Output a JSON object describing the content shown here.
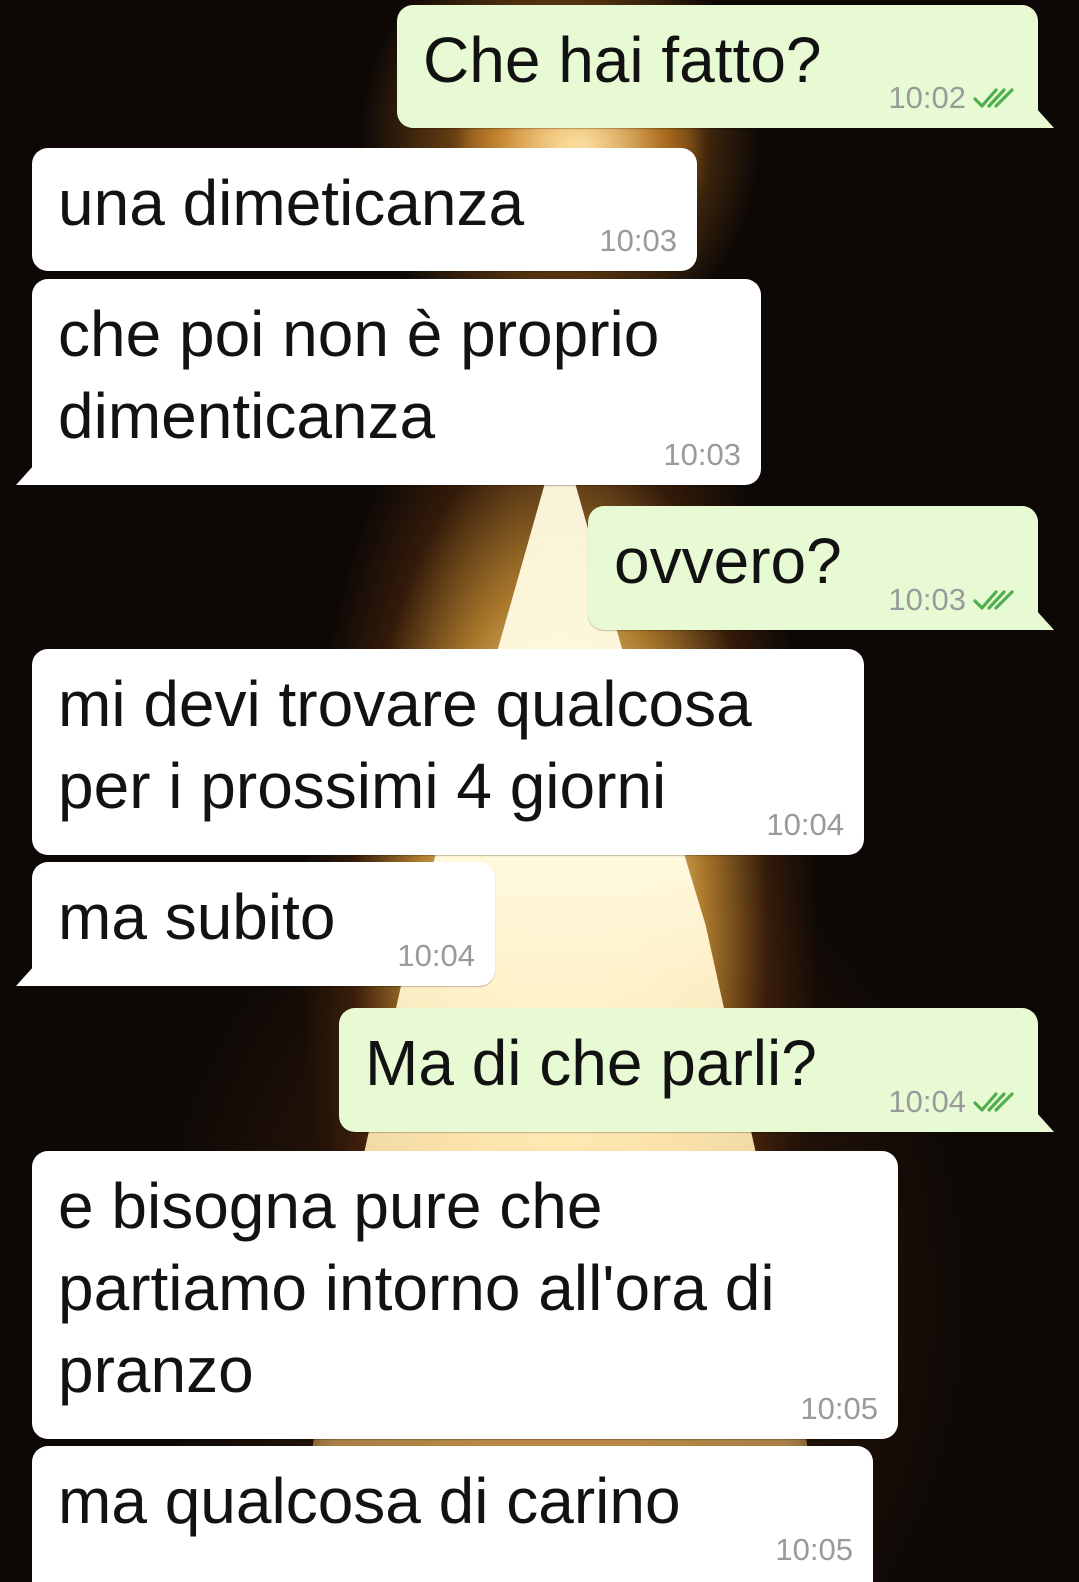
{
  "colors": {
    "incoming_bubble": "#ffffff",
    "outgoing_bubble": "#e7fad4",
    "read_ticks": "#4fae4e",
    "timestamp": "#9a9a9a"
  },
  "messages": [
    {
      "direction": "outgoing",
      "text": "Che hai fatto?",
      "time": "10:02",
      "status_icon": "double-check-read-icon"
    },
    {
      "direction": "incoming",
      "text": "una dimeticanza",
      "time": "10:03"
    },
    {
      "direction": "incoming",
      "text": "che poi non è proprio\ndimenticanza",
      "time": "10:03"
    },
    {
      "direction": "outgoing",
      "text": "ovvero?",
      "time": "10:03",
      "status_icon": "double-check-read-icon"
    },
    {
      "direction": "incoming",
      "text": "mi devi trovare qualcosa\nper i prossimi 4 giorni",
      "time": "10:04"
    },
    {
      "direction": "incoming",
      "text": "ma subito",
      "time": "10:04"
    },
    {
      "direction": "outgoing",
      "text": "Ma di che parli?",
      "time": "10:04",
      "status_icon": "double-check-read-icon"
    },
    {
      "direction": "incoming",
      "text": "e bisogna pure che\npartiamo intorno all'ora di\npranzo",
      "time": "10:05"
    },
    {
      "direction": "incoming",
      "text": "ma qualcosa di carino",
      "time": "10:05"
    }
  ]
}
